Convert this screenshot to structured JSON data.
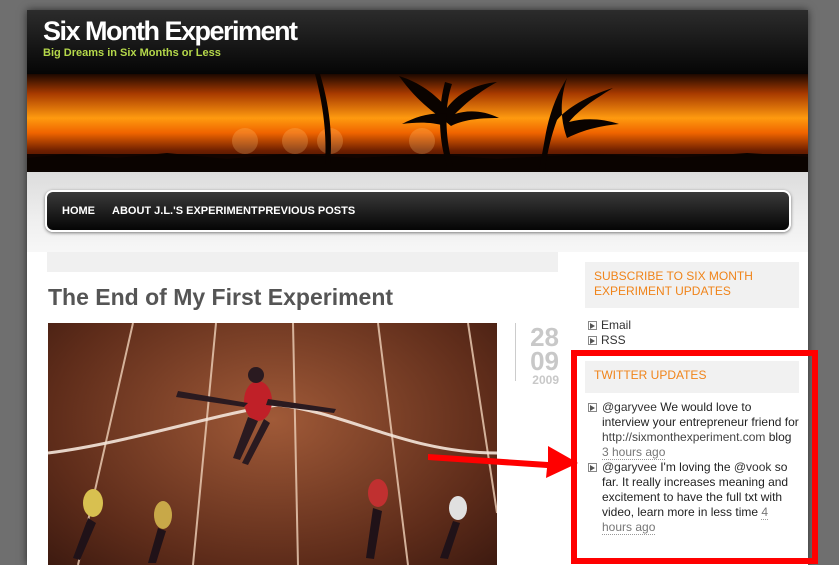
{
  "site": {
    "title": "Six Month Experiment",
    "tagline": "Big Dreams in Six Months or Less"
  },
  "nav": {
    "items": [
      {
        "label": "HOME"
      },
      {
        "label": "ABOUT J.L.'S EXPERIMENT"
      },
      {
        "label": "PREVIOUS POSTS"
      }
    ]
  },
  "post": {
    "title": "The End of My First Experiment",
    "date": {
      "day": "28",
      "month": "09",
      "year": "2009"
    }
  },
  "sidebar": {
    "subscribe_heading": "SUBSCRIBE TO SIX MONTH EXPERIMENT UPDATES",
    "links": [
      {
        "label": "Email"
      },
      {
        "label": "RSS"
      }
    ],
    "twitter_heading": "TWITTER UPDATES",
    "tweets": [
      {
        "user": "@garyvee",
        "text": " We would love to interview your entrepreneur friend for ",
        "url": "http://sixmonthexperiment.com",
        "text2": " blog ",
        "time": "3 hours ago"
      },
      {
        "user": "@garyvee",
        "text": " I'm loving the ",
        "mention": "@vook",
        "text2": " so far. It really increases meaning and excitement to have the full txt with video, learn more in less time ",
        "time": "4 hours ago"
      }
    ]
  },
  "colors": {
    "accent_orange": "#f0841a",
    "tagline_green": "#b5d84a",
    "annotation_red": "#ff0000"
  }
}
